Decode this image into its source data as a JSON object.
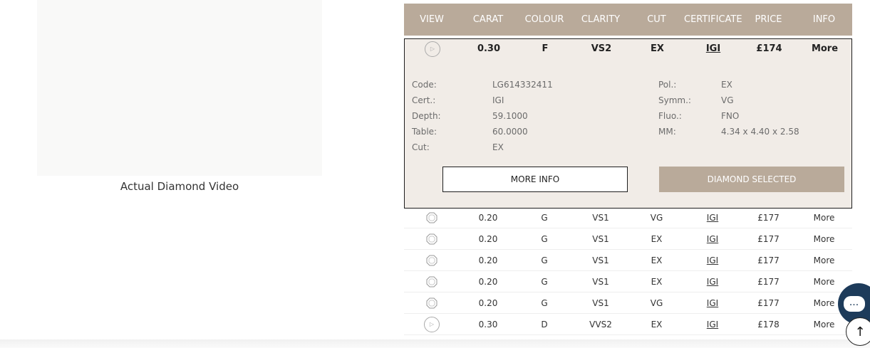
{
  "video": {
    "caption": "Actual Diamond Video"
  },
  "table": {
    "headers": [
      "VIEW",
      "CARAT",
      "COLOUR",
      "CLARITY",
      "CUT",
      "CERTIFICATE",
      "PRICE",
      "INFO"
    ]
  },
  "selected": {
    "carat": "0.30",
    "colour": "F",
    "clarity": "VS2",
    "cut": "EX",
    "cert": "IGI",
    "price": "£174",
    "info": "More",
    "details_left": [
      {
        "label": "Code:",
        "value": "LG614332411"
      },
      {
        "label": "Cert.:",
        "value": "IGI"
      },
      {
        "label": "Depth:",
        "value": "59.1000"
      },
      {
        "label": "Table:",
        "value": "60.0000"
      },
      {
        "label": "Cut:",
        "value": "EX"
      }
    ],
    "details_right": [
      {
        "label": "Pol.:",
        "value": "EX"
      },
      {
        "label": "Symm.:",
        "value": "VG"
      },
      {
        "label": "Fluo.:",
        "value": "FNO"
      },
      {
        "label": "MM:",
        "value": "4.34 x 4.40 x 2.58"
      }
    ],
    "more_info_label": "MORE INFO",
    "selected_label": "DIAMOND SELECTED"
  },
  "rows": [
    {
      "icon": "diamond-icon",
      "carat": "0.20",
      "colour": "G",
      "clarity": "VS1",
      "cut": "VG",
      "cert": "IGI",
      "price": "£177",
      "info": "More"
    },
    {
      "icon": "diamond-icon",
      "carat": "0.20",
      "colour": "G",
      "clarity": "VS1",
      "cut": "EX",
      "cert": "IGI",
      "price": "£177",
      "info": "More"
    },
    {
      "icon": "diamond-icon",
      "carat": "0.20",
      "colour": "G",
      "clarity": "VS1",
      "cut": "EX",
      "cert": "IGI",
      "price": "£177",
      "info": "More"
    },
    {
      "icon": "diamond-icon",
      "carat": "0.20",
      "colour": "G",
      "clarity": "VS1",
      "cut": "EX",
      "cert": "IGI",
      "price": "£177",
      "info": "More"
    },
    {
      "icon": "diamond-icon",
      "carat": "0.20",
      "colour": "G",
      "clarity": "VS1",
      "cut": "VG",
      "cert": "IGI",
      "price": "£177",
      "info": "More"
    },
    {
      "icon": "play-icon",
      "carat": "0.30",
      "colour": "D",
      "clarity": "VVS2",
      "cut": "EX",
      "cert": "IGI",
      "price": "£178",
      "info": "More"
    }
  ],
  "colors": {
    "header_bg": "#b9aa9a",
    "selected_bg": "#f1ece7",
    "chat_bg": "#1d3b5a"
  },
  "widgets": {
    "chat_icon": "chat-bubble-icon",
    "scroll_top_icon": "arrow-up-icon",
    "chat_dots": "...",
    "up_arrow": "↑"
  }
}
